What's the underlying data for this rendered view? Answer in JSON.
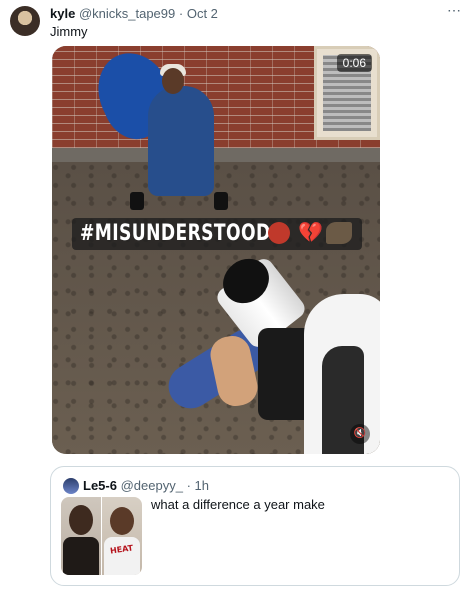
{
  "tweet": {
    "name": "kyle",
    "handle": "@knicks_tape99",
    "dot": "·",
    "date": "Oct 2",
    "text": "Jimmy",
    "more_icon": "⋯"
  },
  "media": {
    "time": "0:06",
    "caption": "#MISUNDERSTOOD",
    "caption_emojis": [
      "devil-face",
      "broken-heart",
      "bat"
    ],
    "heart_glyph": "💔",
    "mute_icon": "🔇"
  },
  "quote": {
    "name": "Le5-6",
    "handle": "@deepyy_",
    "dot": "·",
    "time": "1h",
    "text": "what a difference a year make",
    "jersey_text": "HEAT"
  },
  "colors": {
    "text": "#0f1419",
    "muted": "#536471",
    "border": "#cfd9de",
    "caption_bg": "#1e1e1e"
  }
}
